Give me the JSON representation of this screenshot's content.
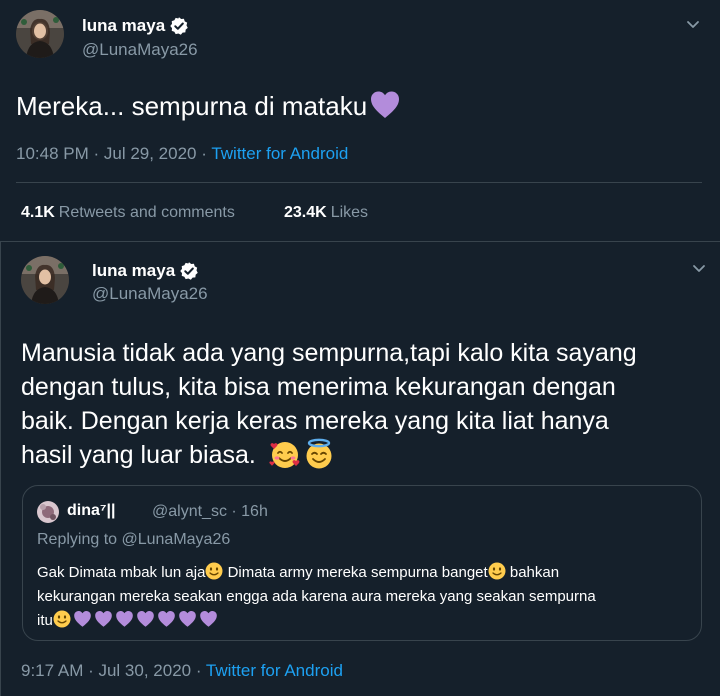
{
  "tweet1": {
    "display_name": "luna maya",
    "handle": "@LunaMaya26",
    "text": "Mereka... sempurna di mataku",
    "time": "10:48 PM · Jul 29, 2020 · ",
    "source": "Twitter for Android",
    "retweets_count": "4.1K",
    "retweets_label": "Retweets and comments",
    "likes_count": "23.4K",
    "likes_label": "Likes"
  },
  "tweet2": {
    "display_name": "luna maya",
    "handle": "@LunaMaya26",
    "text_line1": "Manusia tidak ada yang sempurna,tapi kalo kita sayang",
    "text_line2": "dengan tulus, kita bisa menerima kekurangan dengan",
    "text_line3": "baik. Dengan kerja keras mereka yang kita liat hanya",
    "text_line4": "hasil yang luar biasa.",
    "time": "9:17 AM · Jul 30, 2020 · ",
    "source": "Twitter for Android"
  },
  "quote": {
    "display_name": "dina⁷||",
    "handle": "@alynt_sc · 16h",
    "replying_to": "Replying to @LunaMaya26",
    "text_part1": "Gak Dimata mbak lun aja",
    "text_part2": " Dimata army mereka sempurna banget",
    "text_part3": " bahkan",
    "text_line2": "kekurangan mereka seakan engga ada karena aura mereka yang seakan sempurna",
    "text_line3": "itu"
  },
  "colors": {
    "background": "#15202b",
    "border": "#38444d",
    "secondary_text": "#8899a6",
    "link": "#1da1f2",
    "heart": "#b38cdb"
  },
  "icons": [
    "verified-badge-icon",
    "chevron-down-icon",
    "purple-heart-icon",
    "smiling-face-with-hearts-icon",
    "smiling-face-with-halo-icon",
    "slightly-smiling-face-icon"
  ]
}
